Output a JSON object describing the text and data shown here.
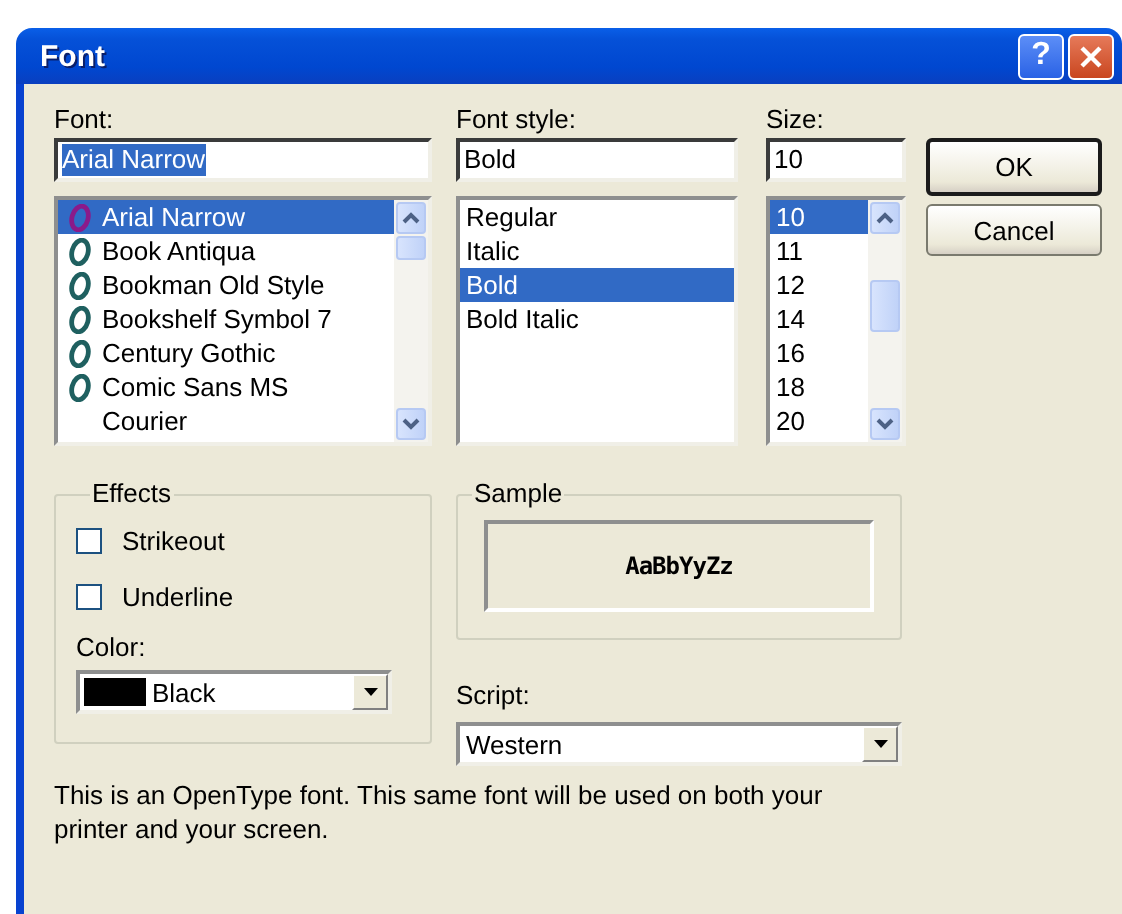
{
  "window": {
    "title": "Font",
    "help_button": "?"
  },
  "font": {
    "label": "Font:",
    "value": "Arial Narrow",
    "items": [
      {
        "label": "Arial Narrow",
        "opentype": true,
        "selected": true
      },
      {
        "label": "Book Antiqua",
        "opentype": true,
        "selected": false
      },
      {
        "label": "Bookman Old Style",
        "opentype": true,
        "selected": false
      },
      {
        "label": "Bookshelf Symbol 7",
        "opentype": true,
        "selected": false
      },
      {
        "label": "Century Gothic",
        "opentype": true,
        "selected": false
      },
      {
        "label": "Comic Sans MS",
        "opentype": true,
        "selected": false
      },
      {
        "label": "Courier",
        "opentype": false,
        "selected": false
      }
    ]
  },
  "font_style": {
    "label": "Font style:",
    "value": "Bold",
    "items": [
      {
        "label": "Regular",
        "selected": false
      },
      {
        "label": "Italic",
        "selected": false
      },
      {
        "label": "Bold",
        "selected": true
      },
      {
        "label": "Bold Italic",
        "selected": false
      }
    ]
  },
  "size": {
    "label": "Size:",
    "value": "10",
    "items": [
      {
        "label": "10",
        "selected": true
      },
      {
        "label": "11",
        "selected": false
      },
      {
        "label": "12",
        "selected": false
      },
      {
        "label": "14",
        "selected": false
      },
      {
        "label": "16",
        "selected": false
      },
      {
        "label": "18",
        "selected": false
      },
      {
        "label": "20",
        "selected": false
      }
    ]
  },
  "buttons": [
    {
      "label": "OK",
      "default": true
    },
    {
      "label": "Cancel",
      "default": false
    }
  ],
  "effects": {
    "title": "Effects",
    "options": [
      {
        "label": "Strikeout",
        "checked": false
      },
      {
        "label": "Underline",
        "checked": false
      }
    ],
    "color_label": "Color:",
    "color": {
      "name": "Black",
      "color": "#000000"
    }
  },
  "sample": {
    "title": "Sample",
    "text": "AaBbYyZz"
  },
  "script": {
    "label": "Script:",
    "value": "Western"
  },
  "note": "This is an OpenType font. This same font will be used on both your printer and your screen."
}
